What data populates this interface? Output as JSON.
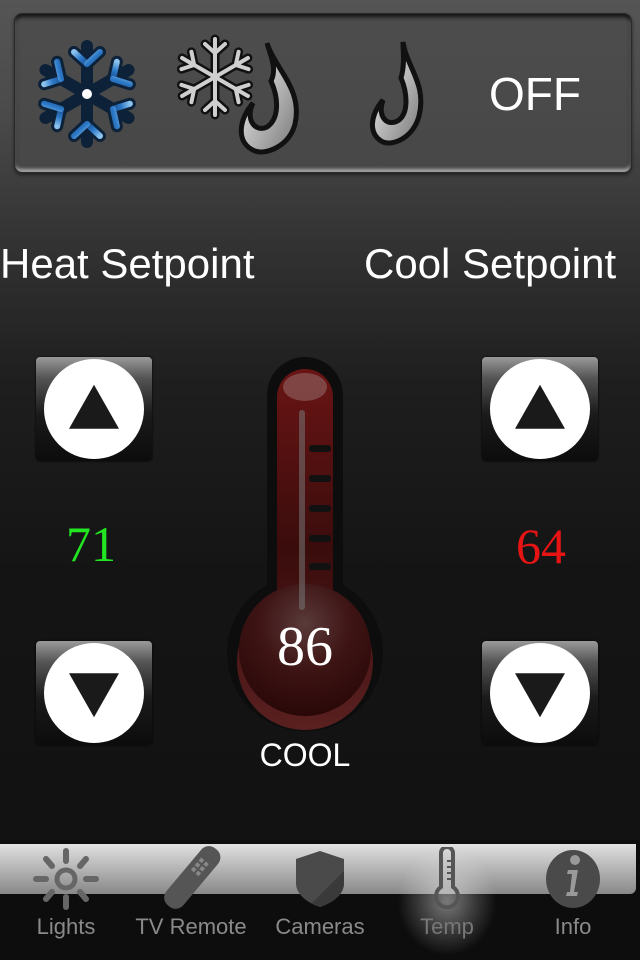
{
  "mode_bar": {
    "modes": [
      {
        "name": "cool",
        "icon": "snowflake-icon"
      },
      {
        "name": "auto",
        "icon": "snowflake-flame-icon"
      },
      {
        "name": "heat",
        "icon": "flame-icon"
      },
      {
        "name": "off",
        "label": "OFF"
      }
    ]
  },
  "heat": {
    "title": "Heat Setpoint",
    "value": "71",
    "color": "#22e622"
  },
  "cool": {
    "title": "Cool Setpoint",
    "value": "64",
    "color": "#e81414"
  },
  "thermostat": {
    "current_temp": "86",
    "mode_status": "COOL"
  },
  "tabs": [
    {
      "label": "Lights",
      "icon": "sun-icon",
      "active": false
    },
    {
      "label": "TV Remote",
      "icon": "remote-icon",
      "active": false
    },
    {
      "label": "Cameras",
      "icon": "shield-icon",
      "active": false
    },
    {
      "label": "Temp",
      "icon": "thermometer-icon",
      "active": true
    },
    {
      "label": "Info",
      "icon": "info-icon",
      "active": false
    }
  ]
}
